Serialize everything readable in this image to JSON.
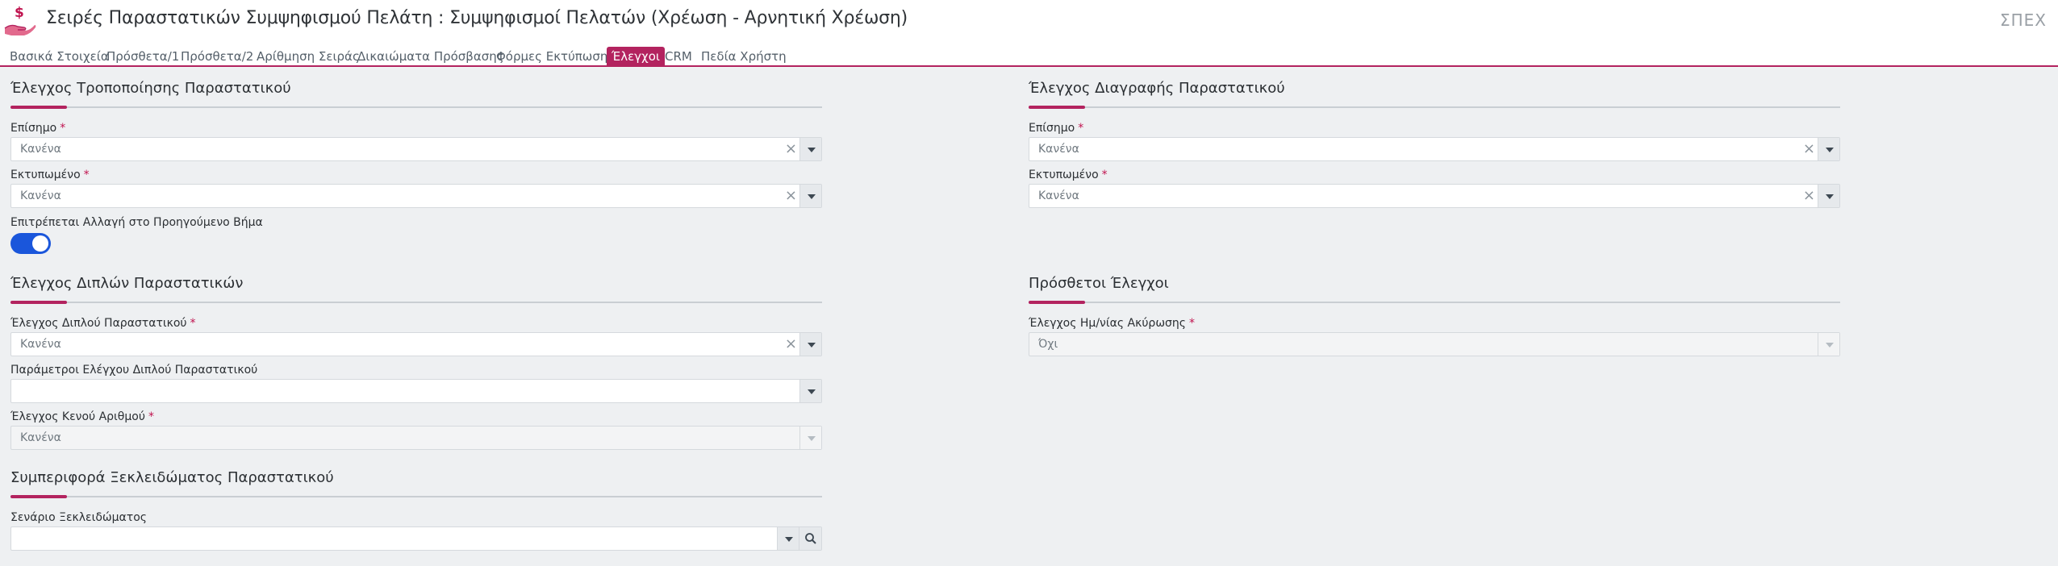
{
  "header": {
    "title": "Σειρές Παραστατικών Συμψηφισμού Πελάτη : Συμψηφισμοί Πελατών (Χρέωση - Αρνητική Χρέωση)",
    "app_code": "ΣΠΕΧ",
    "logo_icon": "hand-dollar-icon"
  },
  "tabs": [
    {
      "label": "Βασικά Στοιχεία",
      "active": false
    },
    {
      "label": "Πρόσθετα/1",
      "active": false
    },
    {
      "label": "Πρόσθετα/2",
      "active": false
    },
    {
      "label": "Αρίθμηση Σειράς",
      "active": false
    },
    {
      "label": "Δικαιώματα Πρόσβασης",
      "active": false
    },
    {
      "label": "Φόρμες Εκτύπωσης",
      "active": false
    },
    {
      "label": "Έλεγχοι",
      "active": true
    },
    {
      "label": "CRM",
      "active": false
    },
    {
      "label": "Πεδία Χρήστη",
      "active": false
    }
  ],
  "modify_check": {
    "title": "Έλεγχος Τροποποίησης Παραστατικού",
    "official_label": "Επίσημο",
    "official_value": "Κανένα",
    "printed_label": "Εκτυπωμένο",
    "printed_value": "Κανένα",
    "allow_change_label": "Επιτρέπεται Αλλαγή στο Προηγούμενο Βήμα",
    "allow_change_on": true
  },
  "delete_check": {
    "title": "Έλεγχος Διαγραφής Παραστατικού",
    "official_label": "Επίσημο",
    "official_value": "Κανένα",
    "printed_label": "Εκτυπωμένο",
    "printed_value": "Κανένα"
  },
  "duplicate_check": {
    "title": "Έλεγχος Διπλών Παραστατικών",
    "dup_label": "Έλεγχος Διπλού Παραστατικού",
    "dup_value": "Κανένα",
    "params_label": "Παράμετροι Ελέγχου Διπλού Παραστατικού",
    "params_value": "",
    "gap_label": "Έλεγχος Κενού Αριθμού",
    "gap_value": "Κανένα"
  },
  "extra_checks": {
    "title": "Πρόσθετοι Έλεγχοι",
    "cancel_date_label": "Έλεγχος Ημ/νίας Ακύρωσης",
    "cancel_date_value": "Όχι"
  },
  "unlock": {
    "title": "Συμπεριφορά Ξεκλειδώματος Παραστατικού",
    "scenario_label": "Σενάριο Ξεκλειδώματος",
    "scenario_value": ""
  },
  "required_mark": "*",
  "clear_glyph": "×",
  "colors": {
    "accent": "#b3235f",
    "toggle_on": "#1a56db"
  }
}
